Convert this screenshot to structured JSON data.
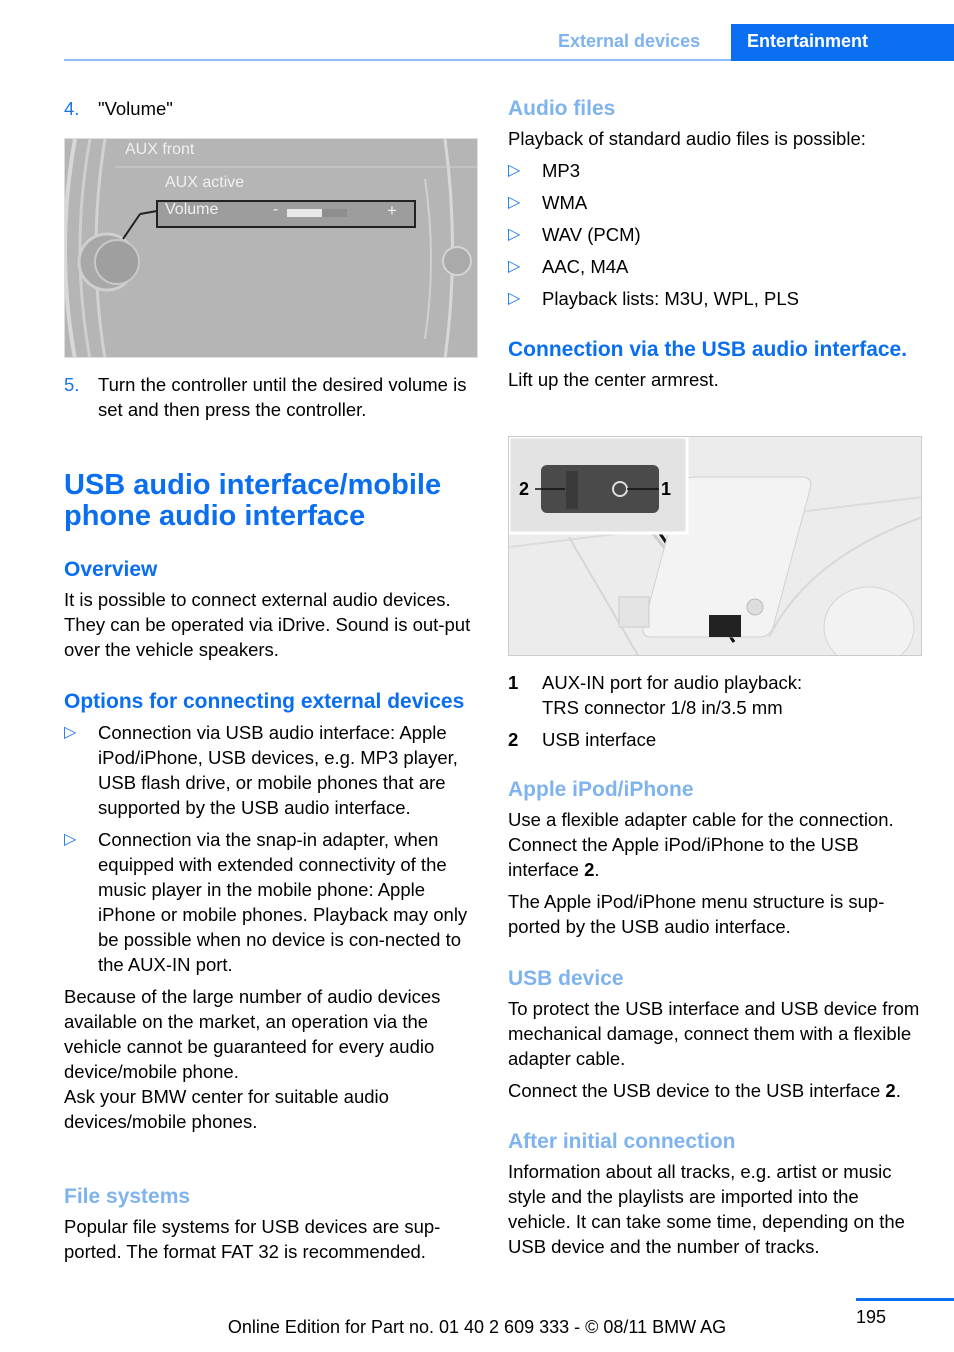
{
  "header": {
    "section": "External devices",
    "chapter": "Entertainment"
  },
  "left": {
    "step4": {
      "num": "4.",
      "text": "\"Volume\""
    },
    "screen": {
      "menu_title": "AUX front",
      "item1": "AUX active",
      "item2": "Volume",
      "minus": "-",
      "plus": "+",
      "volume_level_fraction": 0.35
    },
    "step5": {
      "num": "5.",
      "text": "Turn the controller until the desired volume is set and then press the controller."
    },
    "main_heading": "USB audio interface/mobile phone audio interface",
    "overview": {
      "heading": "Overview",
      "text": "It is possible to connect external audio devices. They can be operated via iDrive. Sound is out-put over the vehicle speakers."
    },
    "options": {
      "heading": "Options for connecting external devices",
      "bullet": "▷",
      "items": [
        "Connection via USB audio interface: Apple iPod/iPhone, USB devices, e.g. MP3 player, USB flash drive, or mobile phones that are supported by the USB audio interface.",
        "Connection via the snap-in adapter, when equipped with extended connectivity of the music player in the mobile phone: Apple iPhone or mobile phones. Playback may only be possible when no device is con-nected to the AUX-IN port."
      ],
      "para1": "Because of the large number of audio devices available on the market, an operation via the vehicle cannot be guaranteed for every audio device/mobile phone.",
      "para2": "Ask your BMW center for suitable audio devices/mobile phones."
    },
    "filesystems": {
      "heading": "File systems",
      "text": "Popular file systems for USB devices are sup-ported. The format FAT 32 is recommended."
    }
  },
  "right": {
    "audio_files": {
      "heading": "Audio files",
      "intro": "Playback of standard audio files is possible:",
      "bullet": "▷",
      "items": [
        "MP3",
        "WMA",
        "WAV (PCM)",
        "AAC, M4A",
        "Playback lists: M3U, WPL, PLS"
      ]
    },
    "connection": {
      "heading": "Connection via the USB audio interface.",
      "text": "Lift up the center armrest."
    },
    "photo": {
      "callout1": "1",
      "callout2": "2"
    },
    "legend": [
      {
        "key": "1",
        "line1": "AUX-IN port for audio playback:",
        "line2": "TRS connector 1/8 in/3.5 mm"
      },
      {
        "key": "2",
        "line1": "USB interface"
      }
    ],
    "ipod": {
      "heading": "Apple iPod/iPhone",
      "para1_pre": "Use a flexible adapter cable for the connection. Connect the Apple iPod/iPhone to the USB interface ",
      "para1_bold": "2",
      "para1_post": ".",
      "para2": "The Apple iPod/iPhone menu structure is sup-ported by the USB audio interface."
    },
    "usb_device": {
      "heading": "USB device",
      "para1": "To protect the USB interface and USB device from mechanical damage, connect them with a flexible adapter cable.",
      "para2_pre": "Connect the USB device to the USB interface ",
      "para2_bold": "2",
      "para2_post": "."
    },
    "after": {
      "heading": "After initial connection",
      "text": "Information about all tracks, e.g. artist or music style and the playlists are imported into the vehicle. It can take some time, depending on the USB device and the number of tracks."
    }
  },
  "footer": {
    "edition": "Online Edition for Part no. 01 40 2 609 333 - © 08/11 BMW AG",
    "page": "195"
  }
}
